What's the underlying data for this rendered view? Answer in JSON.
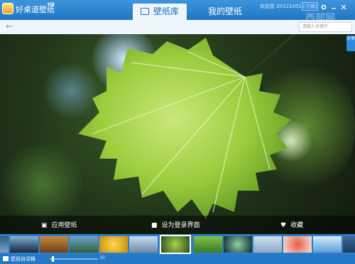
{
  "title_bar": {
    "app_name": "好桌道壁纸",
    "app_version": "HD",
    "tabs": [
      {
        "label": "壁纸库",
        "active": true
      },
      {
        "label": "我的壁纸",
        "active": false
      }
    ],
    "welcome": "欢迎您 20121001",
    "logout": "[注销]",
    "watermark": "西部网"
  },
  "toolbar": {
    "back_icon": "arrow-left",
    "search_placeholder": "请输入关键字"
  },
  "side": {
    "share_label": "分享"
  },
  "actions": [
    {
      "icon": "image-icon",
      "label": "应用壁纸"
    },
    {
      "icon": "user-icon",
      "label": "设为登录界面"
    },
    {
      "icon": "heart-icon",
      "label": "收藏"
    }
  ],
  "status": {
    "auto_change_label": "壁纸自动换",
    "slider_fraction": 0.04,
    "speed_label": "30"
  },
  "colors": {
    "titlebar": "#2a86d6",
    "accent": "#1f6fbd",
    "leaf": "#8fc63a"
  }
}
